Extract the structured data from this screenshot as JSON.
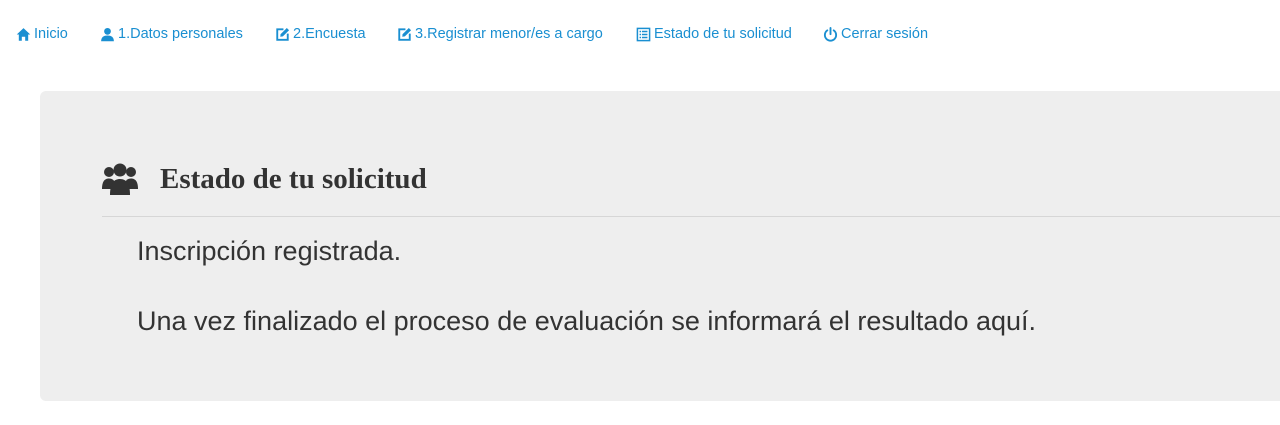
{
  "nav": {
    "items": [
      {
        "label": "Inicio",
        "icon": "home-icon"
      },
      {
        "label": "1.Datos personales",
        "icon": "user-icon"
      },
      {
        "label": "2.Encuesta",
        "icon": "edit-icon"
      },
      {
        "label": "3.Registrar menor/es a cargo",
        "icon": "edit-icon"
      },
      {
        "label": "Estado de tu solicitud",
        "icon": "list-icon"
      },
      {
        "label": "Cerrar sesión",
        "icon": "power-icon"
      }
    ]
  },
  "panel": {
    "title": "Estado de tu solicitud",
    "icon": "users-icon",
    "messages": [
      "Inscripción registrada.",
      "Una vez finalizado el proceso de evaluación se informará el resultado aquí."
    ]
  },
  "colors": {
    "link": "#1a8fd1",
    "panel_background": "#eeeeee",
    "text": "#333333"
  }
}
